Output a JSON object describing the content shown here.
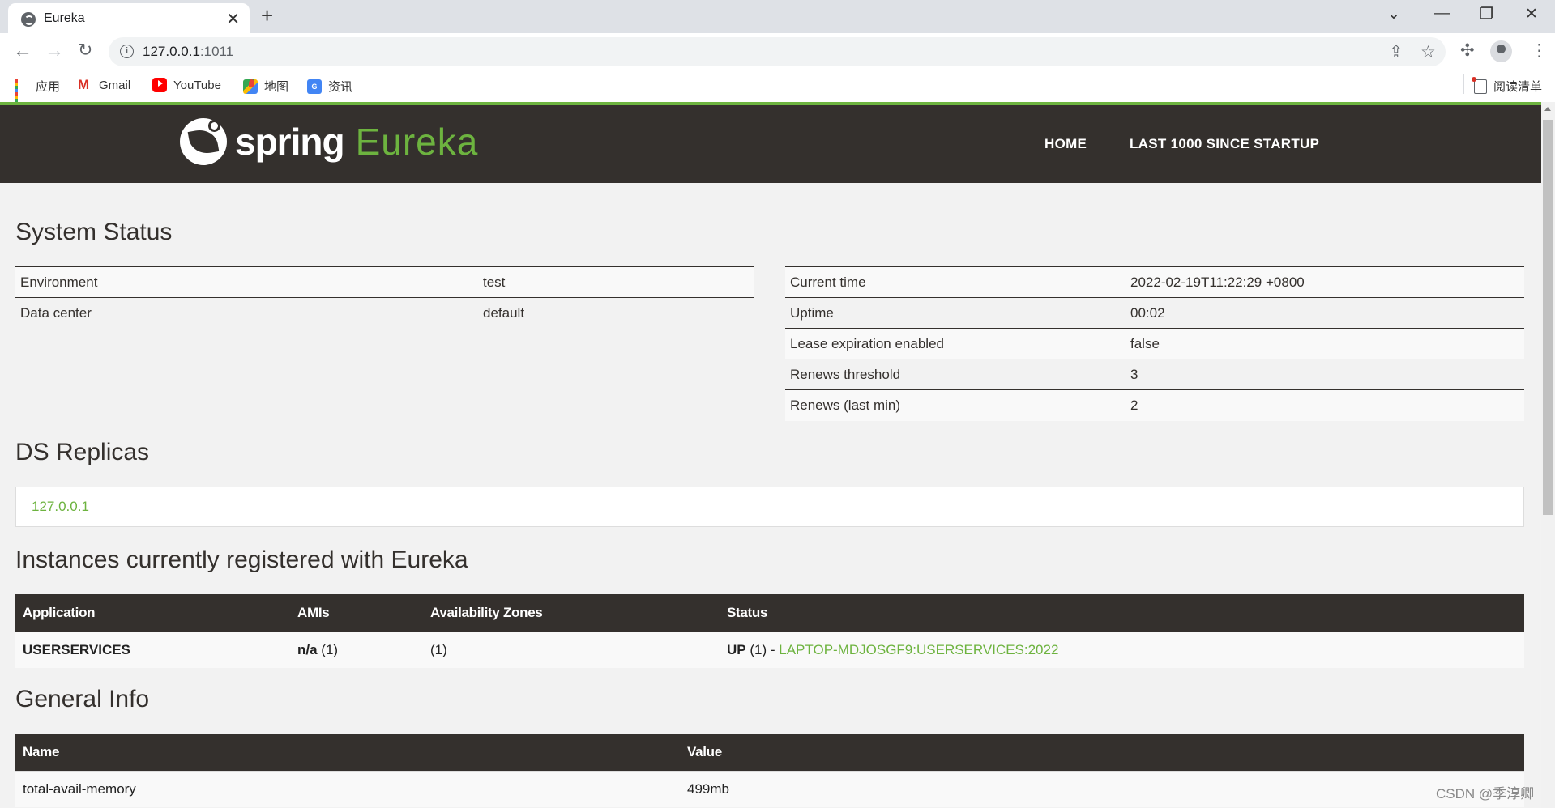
{
  "browser": {
    "tab_title": "Eureka",
    "url_host": "127.0.0.1",
    "url_port": ":1011",
    "bookmarks": [
      "应用",
      "Gmail",
      "YouTube",
      "地图",
      "资讯"
    ],
    "reading_list": "阅读清单"
  },
  "navbar": {
    "brand_spring": "spring",
    "brand_eureka": "Eureka",
    "links": [
      "HOME",
      "LAST 1000 SINCE STARTUP"
    ]
  },
  "system_status": {
    "heading": "System Status",
    "left": [
      {
        "label": "Environment",
        "value": "test"
      },
      {
        "label": "Data center",
        "value": "default"
      }
    ],
    "right": [
      {
        "label": "Current time",
        "value": "2022-02-19T11:22:29 +0800"
      },
      {
        "label": "Uptime",
        "value": "00:02"
      },
      {
        "label": "Lease expiration enabled",
        "value": "false"
      },
      {
        "label": "Renews threshold",
        "value": "3"
      },
      {
        "label": "Renews (last min)",
        "value": "2"
      }
    ]
  },
  "ds_replicas": {
    "heading": "DS Replicas",
    "replica": "127.0.0.1"
  },
  "instances": {
    "heading": "Instances currently registered with Eureka",
    "columns": [
      "Application",
      "AMIs",
      "Availability Zones",
      "Status"
    ],
    "rows": [
      {
        "application": "USERSERVICES",
        "amis": "n/a",
        "amis_count": "(1)",
        "zones": "(1)",
        "status": "UP",
        "status_count": "(1) -",
        "instance_link": "LAPTOP-MDJOSGF9:USERSERVICES:2022"
      }
    ]
  },
  "general_info": {
    "heading": "General Info",
    "columns": [
      "Name",
      "Value"
    ],
    "rows": [
      {
        "name": "total-avail-memory",
        "value": "499mb"
      }
    ]
  },
  "watermark": "CSDN @季淳卿"
}
